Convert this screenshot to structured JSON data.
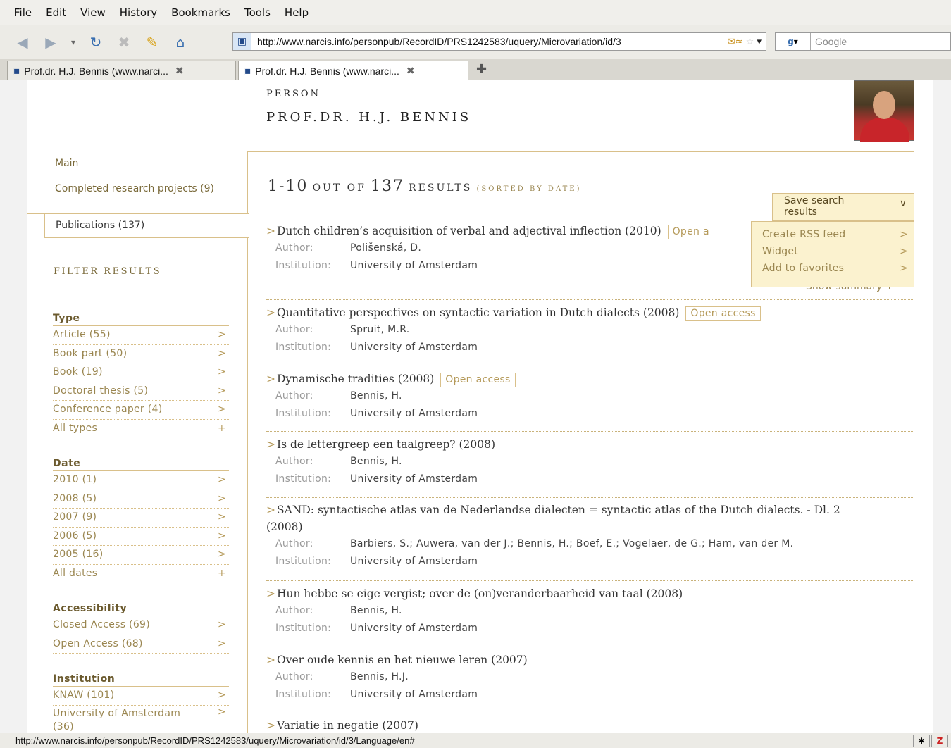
{
  "browser": {
    "menu": [
      "File",
      "Edit",
      "View",
      "History",
      "Bookmarks",
      "Tools",
      "Help"
    ],
    "url": "http://www.narcis.info/personpub/RecordID/PRS1242583/uquery/Microvariation/id/3",
    "search_placeholder": "Google",
    "tabs": [
      {
        "title": "Prof.dr. H.J. Bennis (www.narci...",
        "active": false
      },
      {
        "title": "Prof.dr. H.J. Bennis (www.narci...",
        "active": true
      }
    ],
    "status_url": "http://www.narcis.info/personpub/RecordID/PRS1242583/uquery/Microvariation/id/3/Language/en#"
  },
  "person": {
    "label": "PERSON",
    "name": "PROF.DR. H.J. BENNIS"
  },
  "nav": {
    "main": "Main",
    "completed": "Completed research projects (9)",
    "publications": "Publications (137)"
  },
  "filter": {
    "title": "FILTER RESULTS",
    "type": {
      "heading": "Type",
      "items": [
        "Article (55)",
        "Book part (50)",
        "Book (19)",
        "Doctoral thesis (5)",
        "Conference paper (4)",
        "All types"
      ]
    },
    "date": {
      "heading": "Date",
      "items": [
        "2010 (1)",
        "2008 (5)",
        "2007 (9)",
        "2006 (5)",
        "2005 (16)",
        "All dates"
      ]
    },
    "accessibility": {
      "heading": "Accessibility",
      "items": [
        "Closed Access (69)",
        "Open Access (68)"
      ]
    },
    "institution": {
      "heading": "Institution",
      "items": [
        "KNAW (101)",
        "University of Amsterdam (36)"
      ]
    }
  },
  "results": {
    "range": "1-10",
    "out_of": "OUT OF",
    "total": "137",
    "results_word": "RESULTS",
    "sorted": "(SORTED BY DATE)",
    "save_search": "Save search results",
    "dropdown": [
      "Create RSS feed",
      "Widget",
      "Add to favorites"
    ],
    "show_summary": "Show summary",
    "author_label": "Author:",
    "institution_label": "Institution:",
    "open_access": "Open access",
    "items": [
      {
        "title": "Dutch children’s acquisition of verbal and adjectival inflection (2010)",
        "oa": "Open a",
        "author": "Polišenská, D.",
        "institution": "University of Amsterdam"
      },
      {
        "title": "Quantitative perspectives on syntactic variation in Dutch dialects (2008)",
        "oa": "Open access",
        "author": "Spruit, M.R.",
        "institution": "University of Amsterdam"
      },
      {
        "title": "Dynamische tradities (2008)",
        "oa": "Open access",
        "author": "Bennis, H.",
        "institution": "University of Amsterdam"
      },
      {
        "title": "Is de lettergreep een taalgreep? (2008)",
        "author": "Bennis, H.",
        "institution": "University of Amsterdam"
      },
      {
        "title": "SAND: syntactische atlas van de Nederlandse dialecten = syntactic atlas of the Dutch dialects. - Dl. 2",
        "title2": "(2008)",
        "author": "Barbiers, S.; Auwera, van der J.; Bennis, H.; Boef, E.; Vogelaer, de G.; Ham, van der M.",
        "institution": "University of Amsterdam"
      },
      {
        "title": "Hun hebbe se eige vergist; over de (on)veranderbaarheid van taal (2008)",
        "author": "Bennis, H.",
        "institution": "University of Amsterdam"
      },
      {
        "title": "Over oude kennis en het nieuwe leren (2007)",
        "author": "Bennis, H.J.",
        "institution": "University of Amsterdam"
      },
      {
        "title": "Variatie in negatie (2007)"
      }
    ]
  }
}
